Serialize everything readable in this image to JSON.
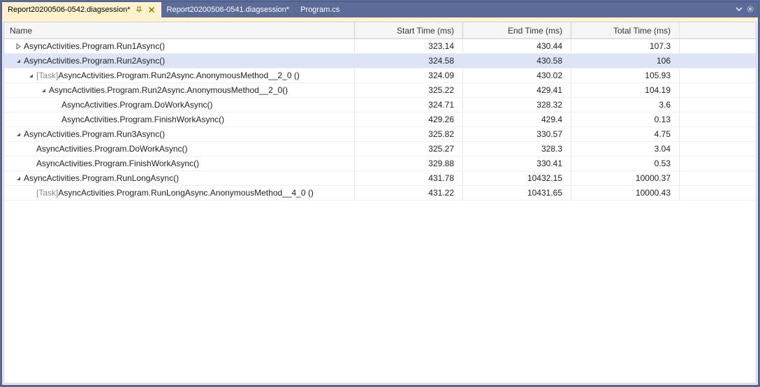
{
  "tabs": [
    {
      "label": "Report20200506-0542.diagsession*",
      "active": true,
      "pinned": true,
      "closable": true
    },
    {
      "label": "Report20200506-0541.diagsession*",
      "active": false,
      "pinned": false,
      "closable": false
    },
    {
      "label": "Program.cs",
      "active": false,
      "pinned": false,
      "closable": false
    }
  ],
  "columns": {
    "name": "Name",
    "start": "Start Time (ms)",
    "end": "End Time (ms)",
    "total": "Total Time (ms)"
  },
  "rows": [
    {
      "depth": 0,
      "expander": "collapsed",
      "prefix": "",
      "label": "AsyncActivities.Program.Run1Async()",
      "start": "323.14",
      "end": "430.44",
      "total": "107.3",
      "selected": false
    },
    {
      "depth": 0,
      "expander": "expanded",
      "prefix": "",
      "label": "AsyncActivities.Program.Run2Async()",
      "start": "324.58",
      "end": "430.58",
      "total": "106",
      "selected": true
    },
    {
      "depth": 1,
      "expander": "expanded",
      "prefix": "[Task] ",
      "label": "AsyncActivities.Program.Run2Async.AnonymousMethod__2_0 ()",
      "start": "324.09",
      "end": "430.02",
      "total": "105.93",
      "selected": false
    },
    {
      "depth": 2,
      "expander": "expanded",
      "prefix": "",
      "label": "AsyncActivities.Program.Run2Async.AnonymousMethod__2_0()",
      "start": "325.22",
      "end": "429.41",
      "total": "104.19",
      "selected": false
    },
    {
      "depth": 3,
      "expander": "none",
      "prefix": "",
      "label": "AsyncActivities.Program.DoWorkAsync()",
      "start": "324.71",
      "end": "328.32",
      "total": "3.6",
      "selected": false
    },
    {
      "depth": 3,
      "expander": "none",
      "prefix": "",
      "label": "AsyncActivities.Program.FinishWorkAsync()",
      "start": "429.26",
      "end": "429.4",
      "total": "0.13",
      "selected": false
    },
    {
      "depth": 0,
      "expander": "expanded",
      "prefix": "",
      "label": "AsyncActivities.Program.Run3Async()",
      "start": "325.82",
      "end": "330.57",
      "total": "4.75",
      "selected": false
    },
    {
      "depth": 1,
      "expander": "none",
      "prefix": "",
      "label": "AsyncActivities.Program.DoWorkAsync()",
      "start": "325.27",
      "end": "328.3",
      "total": "3.04",
      "selected": false
    },
    {
      "depth": 1,
      "expander": "none",
      "prefix": "",
      "label": "AsyncActivities.Program.FinishWorkAsync()",
      "start": "329.88",
      "end": "330.41",
      "total": "0.53",
      "selected": false
    },
    {
      "depth": 0,
      "expander": "expanded",
      "prefix": "",
      "label": "AsyncActivities.Program.RunLongAsync()",
      "start": "431.78",
      "end": "10432.15",
      "total": "10000.37",
      "selected": false
    },
    {
      "depth": 1,
      "expander": "none",
      "prefix": "[Task] ",
      "label": "AsyncActivities.Program.RunLongAsync.AnonymousMethod__4_0 ()",
      "start": "431.22",
      "end": "10431.65",
      "total": "10000.43",
      "selected": false
    }
  ]
}
